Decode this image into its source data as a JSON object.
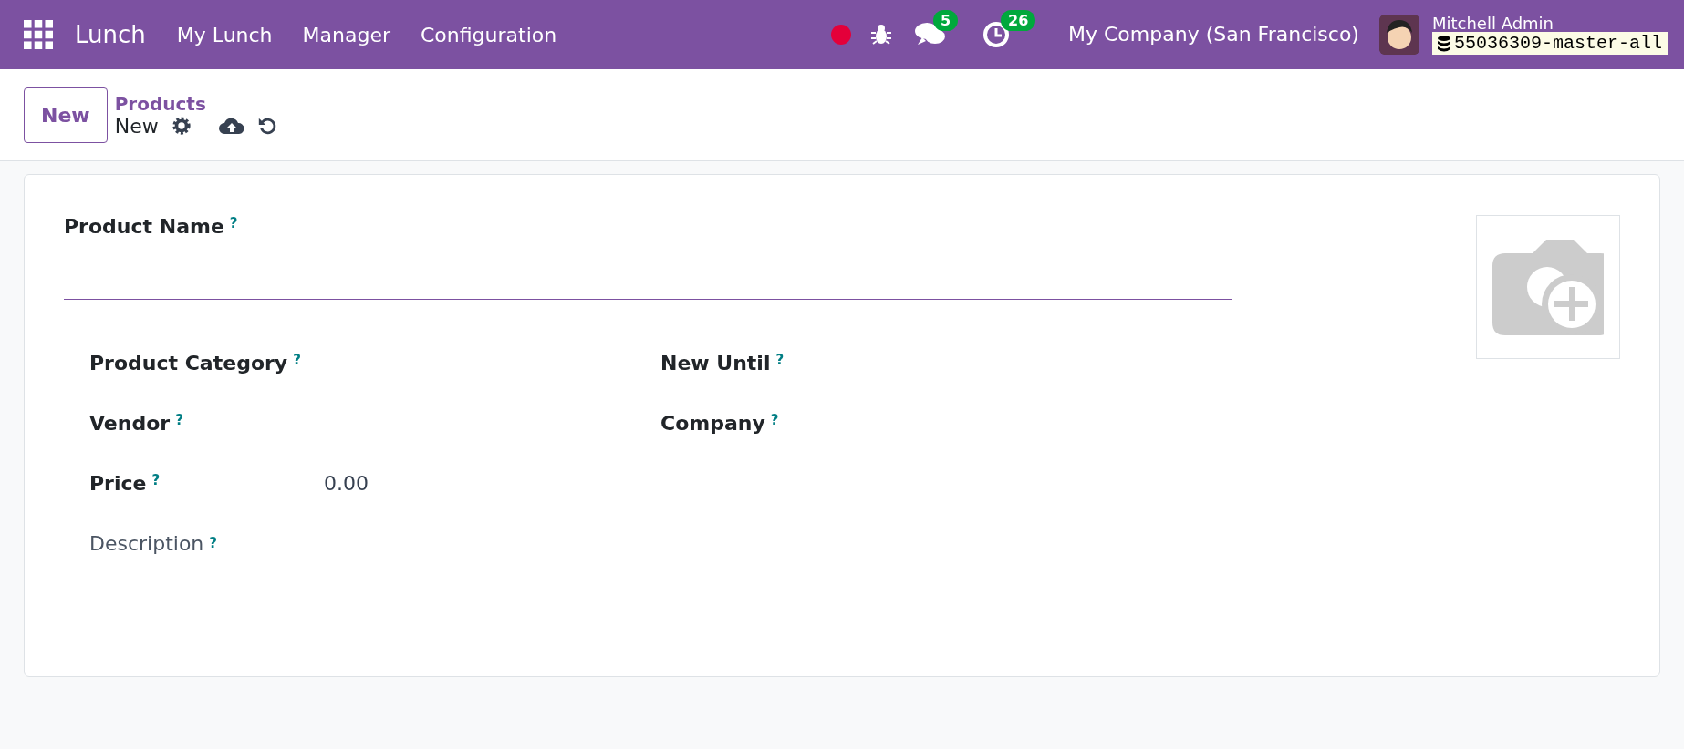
{
  "navbar": {
    "app_name": "Lunch",
    "menu": [
      "My Lunch",
      "Manager",
      "Configuration"
    ],
    "messages_count": "5",
    "activities_count": "26",
    "company": "My Company (San Francisco)",
    "user_name": "Mitchell Admin",
    "database": "55036309-master-all"
  },
  "control_panel": {
    "new_button": "New",
    "breadcrumb": "Products",
    "current": "New"
  },
  "form": {
    "name_label": "Product Name",
    "help": "?",
    "left_fields": [
      {
        "label": "Product Category",
        "help": "?"
      },
      {
        "label": "Vendor",
        "help": "?"
      },
      {
        "label": "Price",
        "help": "?",
        "value": "0.00"
      }
    ],
    "right_fields": [
      {
        "label": "New Until",
        "help": "?"
      },
      {
        "label": "Company",
        "help": "?"
      }
    ],
    "description_label": "Description",
    "description_help": "?"
  }
}
